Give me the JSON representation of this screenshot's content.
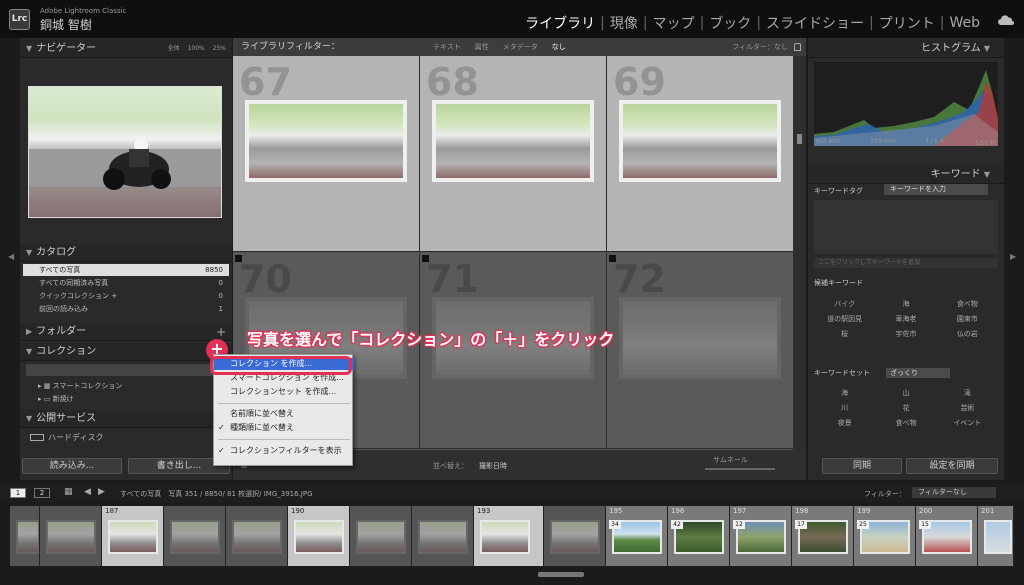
{
  "header": {
    "logo": "Lrc",
    "app_name": "Adobe Lightroom Classic",
    "user_name": "銅城 智樹",
    "modules": [
      "ライブラリ",
      "現像",
      "マップ",
      "ブック",
      "スライドショー",
      "プリント",
      "Web"
    ],
    "active_module": "ライブラリ"
  },
  "left_panel": {
    "navigator": {
      "title": "ナビゲーター",
      "zoom_options": [
        "全体",
        "100%",
        "25%"
      ]
    },
    "catalog": {
      "title": "カタログ",
      "items": [
        {
          "label": "すべての写真",
          "count": "8850"
        },
        {
          "label": "すべての同期済み写真",
          "count": "0"
        },
        {
          "label": "クイックコレクション +",
          "count": "0"
        },
        {
          "label": "前回の読み込み",
          "count": "1"
        }
      ]
    },
    "folders": {
      "title": "フォルダー",
      "add": "+"
    },
    "collections": {
      "title": "コレクション",
      "add": "+",
      "items": [
        "スマートコレクション",
        "新焼け"
      ]
    },
    "publish": {
      "title": "公開サービス",
      "hard_disk": "ハードディスク",
      "setup": "設定"
    },
    "import_button": "読み込み...",
    "export_button": "書き出し..."
  },
  "filter_bar": {
    "title": "ライブラリフィルター：",
    "options": [
      "テキスト",
      "属性",
      "メタデータ",
      "なし"
    ],
    "active": "なし",
    "right_label": "フィルター：",
    "right_value": "なし"
  },
  "grid": {
    "cells": [
      {
        "num": "67",
        "selected_row": true
      },
      {
        "num": "68",
        "selected_row": true
      },
      {
        "num": "69",
        "selected_row": true
      },
      {
        "num": "70",
        "selected_row": false
      },
      {
        "num": "71",
        "selected_row": false
      },
      {
        "num": "72",
        "selected_row": false
      }
    ]
  },
  "toolbar": {
    "sort_label": "並べ替え：",
    "sort_value": "撮影日時",
    "thumb_label": "サムネール"
  },
  "right_panel": {
    "histogram": {
      "title": "ヒストグラム",
      "iso": "ISO 400",
      "focal": "250 mm",
      "aperture": "f / 5.6",
      "shutter": "1/50 秒",
      "original": "元"
    },
    "keyword": {
      "title": "キーワード",
      "tags_label": "キーワードタグ",
      "tags_select": "キーワードを入力",
      "click_hint": "ここをクリックしてキーワードを追加",
      "suggest_title": "候補キーワード",
      "suggestions": [
        "バイク",
        "海",
        "食べ物",
        "道の駅因見",
        "車海老",
        "園東市",
        "桜",
        "宇佐市",
        "仏の岩"
      ],
      "set_title": "キーワードセット",
      "set_select": "ざっくり",
      "set_items": [
        "海",
        "山",
        "滝",
        "川",
        "花",
        "芸術",
        "夜景",
        "食べ物",
        "イベント"
      ]
    },
    "sync_button": "同期",
    "sync_settings_button": "設定を同期"
  },
  "film_bar": {
    "page1": "1",
    "page2": "2",
    "path": "すべての写真　写真 351 / 8850/ 81 枚選択/ IMG_3916.JPG",
    "filter_label": "フィルター：",
    "filter_value": "フィルターなし"
  },
  "film_strip": {
    "cells": [
      {
        "num": "",
        "type": "dim",
        "badge": ""
      },
      {
        "num": "",
        "type": "dim",
        "badge": ""
      },
      {
        "num": "187",
        "type": "sel",
        "badge": ""
      },
      {
        "num": "",
        "type": "dim",
        "badge": ""
      },
      {
        "num": "",
        "type": "dim",
        "badge": ""
      },
      {
        "num": "190",
        "type": "sel",
        "badge": ""
      },
      {
        "num": "",
        "type": "dim",
        "badge": ""
      },
      {
        "num": "",
        "type": "dim",
        "badge": ""
      },
      {
        "num": "193",
        "type": "sel",
        "badge": ""
      },
      {
        "num": "",
        "type": "dim",
        "badge": ""
      },
      {
        "num": "195",
        "type": "norm",
        "badge": "34"
      },
      {
        "num": "196",
        "type": "norm",
        "badge": "42"
      },
      {
        "num": "197",
        "type": "norm",
        "badge": "12"
      },
      {
        "num": "198",
        "type": "norm",
        "badge": "17"
      },
      {
        "num": "199",
        "type": "norm",
        "badge": "25"
      },
      {
        "num": "200",
        "type": "norm",
        "badge": "15"
      },
      {
        "num": "201",
        "type": "norm",
        "badge": ""
      }
    ]
  },
  "context_menu": {
    "items": [
      "コレクション を作成...",
      "スマートコレクション を作成...",
      "コレクションセット を作成...",
      "名前順に並べ替え",
      "種類順に並べ替え",
      "コレクションフィルターを表示"
    ],
    "highlighted": "コレクション を作成..."
  },
  "annotation": {
    "callout": "写真を選んで「コレクション」の「＋」をクリック",
    "plus": "+"
  }
}
